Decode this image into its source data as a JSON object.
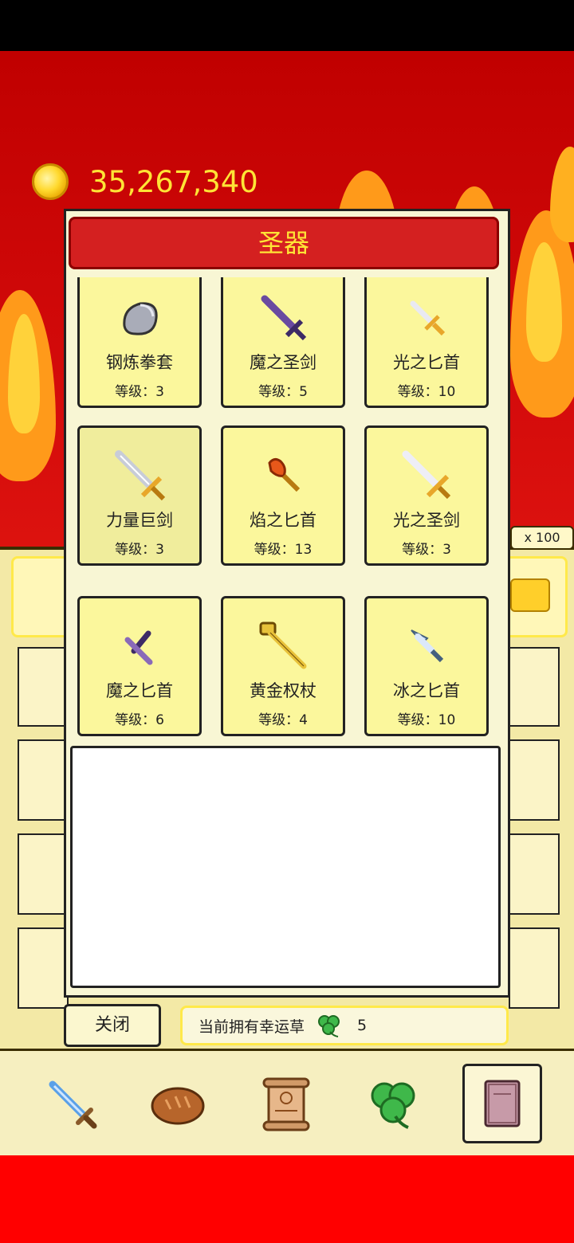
{
  "currency": {
    "coins": "35,267,340"
  },
  "panel": {
    "title": "圣器",
    "items": [
      {
        "name": "钢炼拳套",
        "level": "等级：3",
        "icon": "gauntlet-icon"
      },
      {
        "name": "魔之圣剑",
        "level": "等级：5",
        "icon": "purple-sword-icon"
      },
      {
        "name": "光之匕首",
        "level": "等级：10",
        "icon": "light-dagger-icon"
      },
      {
        "name": "力量巨剑",
        "level": "等级：3",
        "icon": "great-sword-icon"
      },
      {
        "name": "焰之匕首",
        "level": "等级：13",
        "icon": "flame-dagger-icon"
      },
      {
        "name": "光之圣剑",
        "level": "等级：3",
        "icon": "light-sword-icon"
      },
      {
        "name": "魔之匕首",
        "level": "等级：6",
        "icon": "purple-dagger-icon"
      },
      {
        "name": "黄金权杖",
        "level": "等级：4",
        "icon": "golden-scepter-icon"
      },
      {
        "name": "冰之匕首",
        "level": "等级：10",
        "icon": "ice-dagger-icon"
      }
    ],
    "close_label": "关闭",
    "clover_label": "当前拥有幸运草",
    "clover_count": "5"
  },
  "background": {
    "shop_badge": "x 100"
  },
  "bottom_nav": [
    "sword-icon",
    "bread-icon",
    "scroll-icon",
    "clover-icon",
    "book-icon"
  ]
}
